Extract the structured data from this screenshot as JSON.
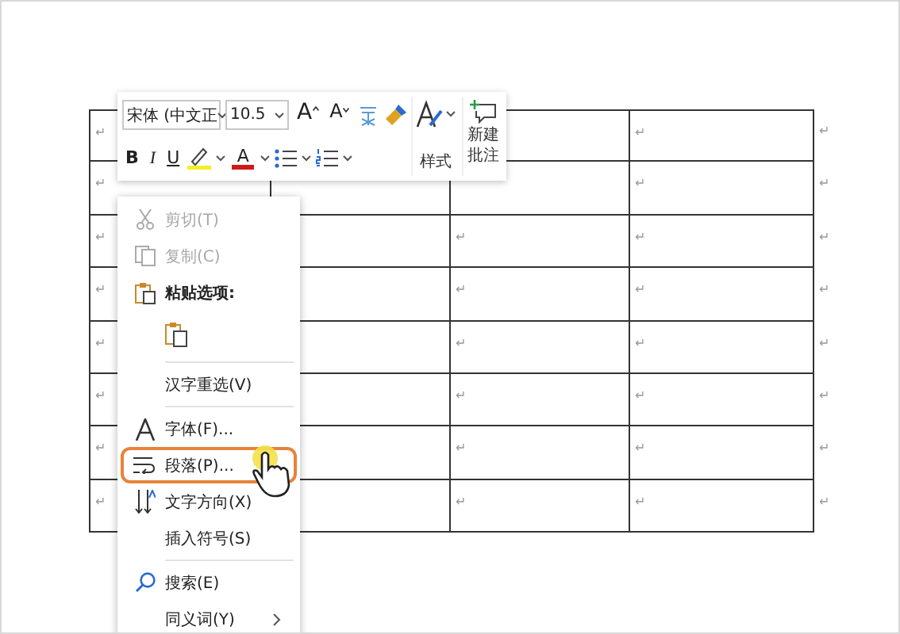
{
  "toolbar": {
    "font": "宋体 (中文正",
    "size": "10.5",
    "grow": "A",
    "shrink": "A",
    "bold": "B",
    "italic": "I",
    "underline": "U",
    "font_color": "A",
    "styles": "样式",
    "comment": "新建批注"
  },
  "context_menu": [
    {
      "kind": "item",
      "label": "剪切(T)",
      "disabled": true,
      "selected": false
    },
    {
      "kind": "item",
      "label": "复制(C)",
      "disabled": true,
      "selected": false
    },
    {
      "kind": "header",
      "label": "粘贴选项:"
    },
    {
      "kind": "paste-option"
    },
    {
      "kind": "separator"
    },
    {
      "kind": "item",
      "label": "汉字重选(V)",
      "disabled": false,
      "selected": false
    },
    {
      "kind": "separator"
    },
    {
      "kind": "item",
      "label": "字体(F)...",
      "disabled": false,
      "selected": false
    },
    {
      "kind": "item",
      "label": "段落(P)...",
      "disabled": false,
      "selected": true
    },
    {
      "kind": "item",
      "label": "文字方向(X)",
      "disabled": false,
      "selected": false
    },
    {
      "kind": "item",
      "label": "插入符号(S)",
      "disabled": false,
      "selected": false
    },
    {
      "kind": "separator"
    },
    {
      "kind": "item",
      "label": "搜索(E)",
      "disabled": false,
      "selected": false
    },
    {
      "kind": "item",
      "label": "同义词(Y)",
      "disabled": false,
      "selected": false,
      "submenu": true
    }
  ],
  "table": {
    "rows": [
      {
        "cells": [
          {
            "mark": "↵"
          },
          {},
          {},
          {
            "mark": "↵"
          }
        ],
        "end": "↵"
      },
      {
        "cells": [
          {
            "mark": "↵"
          },
          {},
          {},
          {
            "mark": "↵"
          }
        ],
        "end": "↵"
      },
      {
        "cells": [
          {
            "mark": "↵"
          },
          {},
          {
            "mark": "↵"
          },
          {
            "mark": "↵"
          }
        ],
        "end": "↵"
      },
      {
        "cells": [
          {
            "mark": "↵"
          },
          {},
          {
            "mark": "↵"
          },
          {
            "mark": "↵"
          }
        ],
        "end": "↵"
      },
      {
        "cells": [
          {
            "mark": "↵"
          },
          {},
          {
            "mark": "↵"
          },
          {
            "mark": "↵"
          }
        ],
        "end": "↵"
      },
      {
        "cells": [
          {
            "mark": "↵"
          },
          {},
          {
            "mark": "↵"
          },
          {
            "mark": "↵"
          }
        ],
        "end": "↵"
      },
      {
        "cells": [
          {
            "mark": "↵"
          },
          {},
          {
            "mark": "↵"
          },
          {
            "mark": "↵"
          }
        ],
        "end": "↵"
      },
      {
        "cells": [
          {
            "mark": "↵"
          },
          {},
          {
            "mark": "↵"
          },
          {
            "mark": "↵"
          }
        ],
        "end": "↵"
      }
    ]
  }
}
